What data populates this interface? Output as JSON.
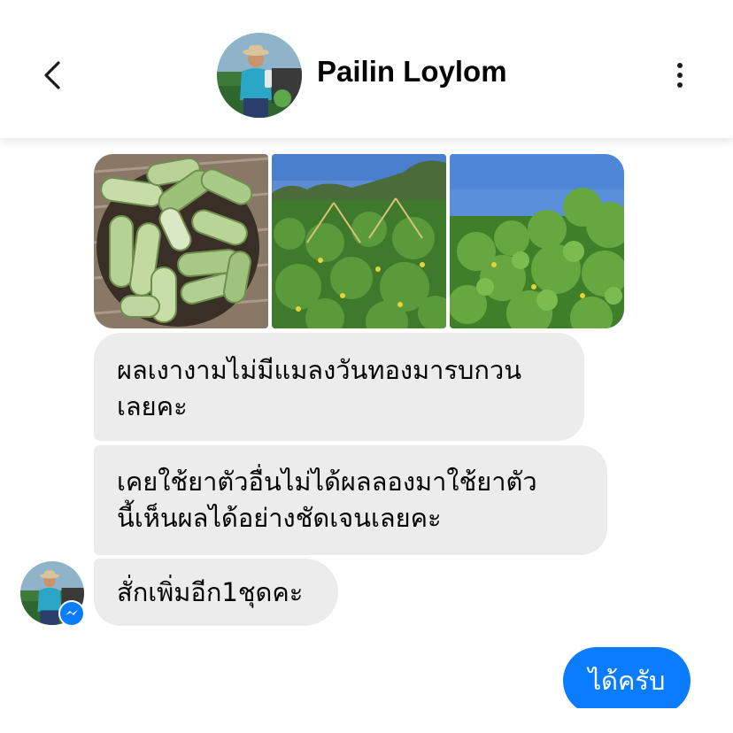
{
  "header": {
    "back_icon": "chevron-left-icon",
    "contact_name": "Pailin Loylom",
    "menu_icon": "more-vertical-icon"
  },
  "photos": [
    {
      "subject": "cucumbers-in-basket"
    },
    {
      "subject": "cucumber-field-rows"
    },
    {
      "subject": "cucumber-vines-leaves"
    }
  ],
  "messages_in": [
    {
      "text": "ผลเงางามไม่มีแมลงวันทองมารบกวน\nเลยคะ"
    },
    {
      "text": "เคยใช้ยาตัวอื่นไม่ได้ผลลองมาใช้ยาตัว\nนี้เห็นผลได้อย่างชัดเจนเลยคะ"
    },
    {
      "text": "สั่กเพิ่มอีก1ชุดคะ"
    }
  ],
  "messages_out": [
    {
      "text": "ได้ครับ"
    }
  ],
  "colors": {
    "incoming_bubble": "#ececec",
    "outgoing_bubble": "#0a7cff",
    "messenger_badge": "#0a7cff"
  }
}
